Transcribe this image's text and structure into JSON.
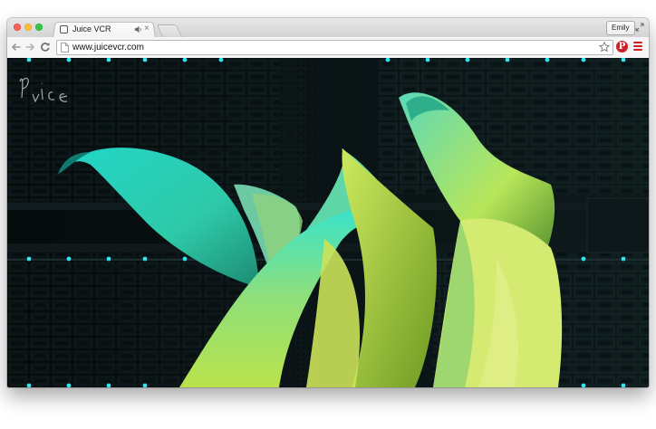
{
  "tab": {
    "title": "Juice VCR"
  },
  "profile": {
    "name": "Emily"
  },
  "address_bar": {
    "url": "www.juicevcr.com"
  },
  "site": {
    "logo_text": "Juice"
  },
  "colors": {
    "accent_dot": "#2ee6f0",
    "flower_cyan": "#2fe0c8",
    "flower_lime": "#c8f050",
    "rack_dark": "#0a1416",
    "pinterest": "#cb2027",
    "menu_red": "#cc2222"
  },
  "icons": {
    "tab_audio": "speaker-icon",
    "bookmark": "star-icon",
    "extension": "pinterest-icon",
    "menu": "hamburger-menu-icon"
  }
}
